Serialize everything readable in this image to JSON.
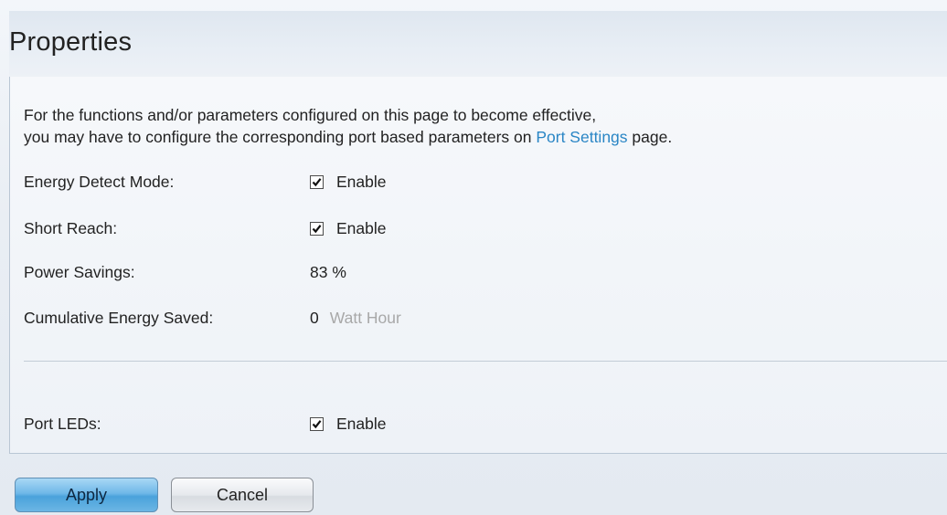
{
  "header": {
    "title": "Properties"
  },
  "intro": {
    "line1": "For the functions and/or parameters configured on this page to become effective,",
    "line2_before": "you may have to configure the corresponding port based parameters on ",
    "link": "Port Settings",
    "line2_after": " page."
  },
  "settings": {
    "energy_detect": {
      "label": "Energy Detect Mode:",
      "checked": true,
      "option": "Enable"
    },
    "short_reach": {
      "label": "Short Reach:",
      "checked": true,
      "option": "Enable"
    },
    "power_savings": {
      "label": "Power Savings:",
      "value": "83 %"
    },
    "energy_saved": {
      "label": "Cumulative Energy Saved:",
      "value": "0",
      "unit": "Watt Hour"
    },
    "port_leds": {
      "label": "Port LEDs:",
      "checked": true,
      "option": "Enable"
    }
  },
  "buttons": {
    "apply": "Apply",
    "cancel": "Cancel"
  },
  "colors": {
    "link": "#2a86c5",
    "apply_button": "#6fb8e8",
    "unit_text": "#a8a8a8"
  }
}
